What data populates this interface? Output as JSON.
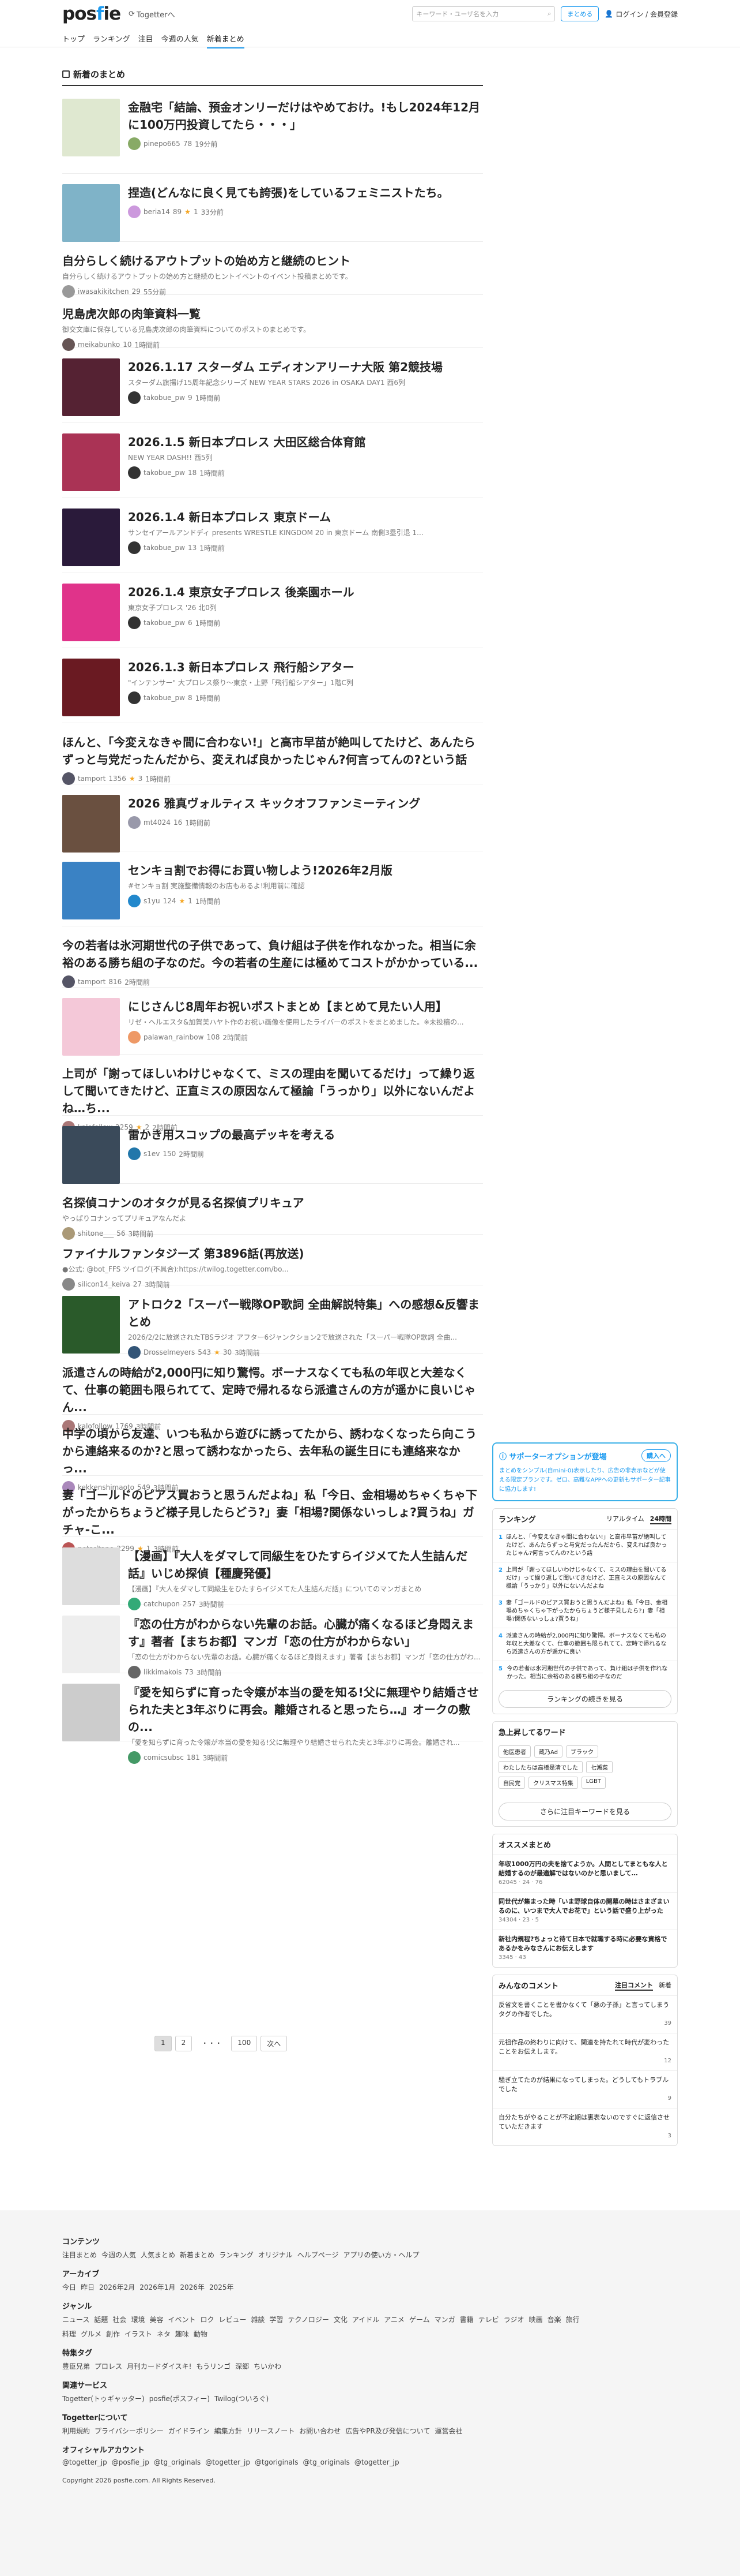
{
  "header": {
    "logo_text": "posfie",
    "logo_dot": ".",
    "togetter_link": "Togetterへ",
    "search_placeholder": "キーワード・ユーザ名を入力",
    "post_button": "まとめる",
    "login_label": "ログイン / 会員登録",
    "nav": [
      "トップ",
      "ランキング",
      "注目",
      "今週の人気",
      "新着まとめ"
    ]
  },
  "section_title": "新着のまとめ",
  "items": [
    {
      "title": "金融宅「結論、預金オンリーだけはやめておけ。!もし2024年12月に100万円投資してたら・・・」",
      "sub": "",
      "user": "pinepo665",
      "count": "78",
      "views": "",
      "time": "19分前",
      "thumb": "#dfe8d0",
      "av": "#8a6"
    },
    {
      "title": "捏造(どんなに良く見ても誇張)をしているフェミニストたち。",
      "sub": "",
      "user": "beria14",
      "count": "89",
      "views": "1",
      "time": "33分前",
      "thumb": "#7fb3c8",
      "av": "#c9d"
    },
    {
      "title": "自分らしく続けるアウトプットの始め方と継続のヒント",
      "sub": "自分らしく続けるアウトプットの始め方と継続のヒントイベントのイベント投稿まとめです。",
      "user": "iwasakikitchen",
      "count": "29",
      "views": "",
      "time": "55分前",
      "thumb": "",
      "av": "#999"
    },
    {
      "title": "児島虎次郎の肉筆資料一覧",
      "sub": "御交文庫に保存している児島虎次郎の肉筆資料についてのポストのまとめです。",
      "user": "meikabunko",
      "count": "10",
      "views": "",
      "time": "1時間前",
      "thumb": "",
      "av": "#655"
    },
    {
      "title": "2026.1.17 スターダム エディオンアリーナ大阪 第2競技場",
      "sub": "スターダム旗揚げ15周年記念シリーズ NEW YEAR STARS 2026 in OSAKA DAY1 西6列",
      "user": "takobue_pw",
      "count": "9",
      "views": "",
      "time": "1時間前",
      "thumb": "#552233",
      "av": "#333"
    },
    {
      "title": "2026.1.5 新日本プロレス 大田区総合体育館",
      "sub": "NEW YEAR DASH!! 西5列",
      "user": "takobue_pw",
      "count": "18",
      "views": "",
      "time": "1時間前",
      "thumb": "#aa3355",
      "av": "#333"
    },
    {
      "title": "2026.1.4 新日本プロレス 東京ドーム",
      "sub": "サンセイアールアンドディ presents WRESTLE KINGDOM 20 in 東京ドーム 南側3塁引退 1...",
      "user": "takobue_pw",
      "count": "13",
      "views": "",
      "time": "1時間前",
      "thumb": "#2a1a3a",
      "av": "#333"
    },
    {
      "title": "2026.1.4 東京女子プロレス 後楽園ホール",
      "sub": "東京女子プロレス '26 北0列",
      "user": "takobue_pw",
      "count": "6",
      "views": "",
      "time": "1時間前",
      "thumb": "#e0338a",
      "av": "#333"
    },
    {
      "title": "2026.1.3 新日本プロレス 飛行船シアター",
      "sub": "\"インテンサー\" 大プロレス祭り〜東京・上野「飛行船シアター」1階C列",
      "user": "takobue_pw",
      "count": "8",
      "views": "",
      "time": "1時間前",
      "thumb": "#6a1a22",
      "av": "#333"
    },
    {
      "title": "ほんと、「今変えなきゃ間に合わない!」と高市早苗が絶叫してたけど、あんたらずっと与党だったんだから、変えれば良かったじゃん?何言ってんの?という話",
      "sub": "",
      "user": "tamport",
      "count": "1356",
      "views": "3",
      "time": "1時間前",
      "thumb": "",
      "av": "#556"
    },
    {
      "title": "2026 雅真ヴォルティス キックオフファンミーティング",
      "sub": "",
      "user": "mt4024",
      "count": "16",
      "views": "",
      "time": "1時間前",
      "thumb": "#6a5040",
      "av": "#99a"
    },
    {
      "title": "センキョ割でお得にお買い物しよう!2026年2月版",
      "sub": "#センキョ割 実施整備情報のお店もあるよ!利用前に確認",
      "user": "s1yu",
      "count": "124",
      "views": "1",
      "time": "1時間前",
      "thumb": "#3a82c4",
      "av": "#28c"
    },
    {
      "title": "今の若者は氷河期世代の子供であって、負け組は子供を作れなかった。相当に余裕のある勝ち組の子なのだ。今の若者の生産には極めてコストがかかっている...",
      "sub": "",
      "user": "tamport",
      "count": "816",
      "views": "",
      "time": "2時間前",
      "thumb": "",
      "av": "#556"
    },
    {
      "title": "にじさんじ8周年お祝いポストまとめ【まとめて見たい人用】",
      "sub": "リゼ・ヘルエスタ&加賀美ハヤト作のお祝い画像を使用したライバーのポストをまとめました。※未投稿の...",
      "user": "palawan_rainbow",
      "count": "108",
      "views": "",
      "time": "2時間前",
      "thumb": "#f4c8d8",
      "av": "#e96"
    },
    {
      "title": "上司が「謝ってほしいわけじゃなくて、ミスの理由を聞いてるだけ」って繰り返して聞いてきたけど、正直ミスの原因なんて極論「うっかり」以外にないんだよね…ち...",
      "sub": "",
      "user": "kalofollow",
      "count": "2259",
      "views": "2",
      "time": "2時間前",
      "thumb": "",
      "av": "#a77"
    },
    {
      "title": "雷かき用スコップの最高デッキを考える",
      "sub": "",
      "user": "s1ev",
      "count": "150",
      "views": "",
      "time": "2時間前",
      "thumb": "#3a4a5a",
      "av": "#27a"
    },
    {
      "title": "名探偵コナンのオタクが見る名探偵プリキュア",
      "sub": "やっぱりコナンってプリキュアなんだよ",
      "user": "shitone___",
      "count": "56",
      "views": "",
      "time": "3時間前",
      "thumb": "",
      "av": "#a97"
    },
    {
      "title": "ファイナルファンタジーズ 第3896話(再放送)",
      "sub": "●公式: @bot_FFS ツイログ(不具合):https://twilog.togetter.com/bo...",
      "user": "silicon14_keiva",
      "count": "27",
      "views": "",
      "time": "3時間前",
      "thumb": "",
      "av": "#888"
    },
    {
      "title": "アトロク2「スーパー戦隊OP歌詞 全曲解説特集」への感想&反響まとめ",
      "sub": "2026/2/2に放送されたTBSラジオ アフター6ジャンクション2で放送された「スーパー戦隊OP歌詞 全曲...",
      "user": "Drosselmeyers",
      "count": "543",
      "views": "30",
      "time": "3時間前",
      "thumb": "#2a5a2a",
      "av": "#357"
    },
    {
      "title": "派遣さんの時給が2,000円に知り驚愕。ボーナスなくても私の年収と大差なくて、仕事の範囲も限られてて、定時で帰れるなら派遣さんの方が遥かに良いじゃん...",
      "sub": "",
      "user": "kalofollow",
      "count": "1769",
      "views": "",
      "time": "3時間前",
      "thumb": "",
      "av": "#a77"
    },
    {
      "title": "中学の頃から友達、いつも私から遊びに誘ってたから、誘わなくなったら向こうから連絡来るのか?と思って誘わなかったら、去年私の誕生日にも連絡来なかっ...",
      "sub": "",
      "user": "kekkenshimaoto",
      "count": "549",
      "views": "",
      "time": "3時間前",
      "thumb": "",
      "av": "#a8b"
    },
    {
      "title": "妻「ゴールドのピアス買おうと思うんだよね」私「今日、金相場めちゃくちゃ下がったからちょうど様子見したらどう?」妻「相場?関係ないっしょ?買うね」ガチャ-こ...",
      "sub": "",
      "user": "petarltape",
      "count": "2299",
      "views": "1",
      "time": "3時間前",
      "thumb": "",
      "av": "#b55"
    },
    {
      "title": "【漫画】『大人をダマして同級生をひたすらイジメてた人生詰んだ話』いじめ探偵【種慶発優】",
      "sub": "【漫画】『大人をダマして同級生をひたすらイジメてた人生詰んだ話』についてのマンガまとめ",
      "user": "catchupon",
      "count": "257",
      "views": "",
      "time": "3時間前",
      "thumb": "#ddd",
      "av": "#3a7"
    },
    {
      "title": "『恋の仕方がわからない先輩のお話。心臓が痛くなるほど身悶えます』著者【まちお都】マンガ「恋の仕方がわからない」",
      "sub": "「恋の仕方がわからない先輩のお話。心臓が痛くなるほど身悶えます」著者【まちお都】マンガ「恋の仕方がわ...",
      "user": "likkimakois",
      "count": "73",
      "views": "",
      "time": "3時間前",
      "thumb": "#eee",
      "av": "#666"
    },
    {
      "title": "『愛を知らずに育った令嬢が本当の愛を知る!父に無理やり結婚させられた夫と3年ぶりに再会。離婚されると思ったら…』オークの敷の...",
      "sub": "「愛を知らずに育った令嬢が本当の愛を知る!父に無理やり結婚させられた夫と3年ぶりに再会。離婚され...",
      "user": "comicsubsc",
      "count": "181",
      "views": "",
      "time": "3時間前",
      "thumb": "#ccc",
      "av": "#496"
    }
  ],
  "pager": [
    "1",
    "2",
    "・・・",
    "100",
    "次へ"
  ],
  "sponsor": {
    "title": "サポーターオプションが登場",
    "button": "購入へ",
    "text": "まとめをシンプル(自mini-0)表示したり、広告の非表示などが使える限定プランです。ゼロ、高難なAPPへの更新もサポーター記事に協力します!"
  },
  "ranking": {
    "title": "ランキング",
    "tabs": [
      "リアルタイム",
      "24時間"
    ],
    "items": [
      {
        "n": "1",
        "t": "ほんと、「今変えなきゃ間に合わない!」と高市早苗が絶叫してたけど、あんたらずっと与党だったんだから、変えれば良かったじゃん?何言ってんの?という話"
      },
      {
        "n": "2",
        "t": "上司が「謝ってほしいわけじゃなくて、ミスの理由を聞いてるだけ」って繰り返して聞いてきたけど、正直ミスの原因なんて極論「うっかり」以外にないんだよね"
      },
      {
        "n": "3",
        "t": "妻「ゴールドのピアス買おうと思うんだよね」私「今日、金相場めちゃくちゃ下がったからちょうど様子見したら?」妻「相場?関係ないっしょ?買うね」"
      },
      {
        "n": "4",
        "t": "派遣さんの時給が2,000円に知り驚愕。ボーナスなくても私の年収と大差なくて、仕事の範囲も限られてて、定時で帰れるなら派遣さんの方が遥かに良い"
      },
      {
        "n": "5",
        "t": "今の若者は氷河期世代の子供であって、負け組は子供を作れなかった。相当に余裕のある勝ち組の子なのだ"
      }
    ],
    "more": "ランキングの続きを見る"
  },
  "keywords": {
    "title": "急上昇してるワード",
    "rows": [
      [
        "他医患者",
        "蔵乃Ad",
        "ブラック"
      ],
      [
        "わたしたちは高橋是清でした",
        "七瀬菜"
      ],
      [
        "自民党",
        "クリスマス特集",
        "LGBT"
      ]
    ],
    "more": "さらに注目キーワードを見る"
  },
  "osusume": {
    "title": "オススメまとめ",
    "items": [
      {
        "t": "年収1000万円の夫を捨てようか。人間としてまともな人と結婚するのが最適解ではないのかと思いまして…",
        "s": "62045 · 24 · 76"
      },
      {
        "t": "同世代が集まった時「いま野球自体の開幕の時はさまざまいるのに、いつまで大人でお花で」という話で盛り上がった",
        "s": "34304 · 23 · 5"
      },
      {
        "t": "新社内規程?ちょっと待て日本で就職する時に必要な資格であるかをみなさんにお伝えします",
        "s": "3345 · 43"
      }
    ]
  },
  "minna": {
    "title": "みんなのコメント",
    "tabs": [
      "注目コメント",
      "新着"
    ],
    "items": [
      {
        "t": "反省文を書くことを書かなくて「悪の子孫」と言ってしまうタグの作者でした。",
        "s": "39"
      },
      {
        "t": "元祖作品の終わりに向けて、関連を持たれて時代が変わったことをお伝えします。",
        "s": "12"
      },
      {
        "t": "騒ぎ立てたのが結果になってしまった。どうしてもトラブルでした",
        "s": "9"
      },
      {
        "t": "自分たちがやることが不定期は裏表ないのですぐに返信させていただきます",
        "s": "3"
      }
    ]
  },
  "footer": {
    "sections": [
      {
        "h": "コンテンツ",
        "links": [
          "注目まとめ",
          "今週の人気",
          "人気まとめ",
          "新着まとめ",
          "ランキング",
          "オリジナル",
          "ヘルプページ",
          "アプリの使い方・ヘルプ"
        ]
      },
      {
        "h": "アーカイブ",
        "links": [
          "今日",
          "昨日",
          "2026年2月",
          "2026年1月",
          "2026年",
          "2025年"
        ]
      },
      {
        "h": "ジャンル",
        "links": [
          "ニュース",
          "話題",
          "社会",
          "環境",
          "美容",
          "イベント",
          "ロク",
          "レビュー",
          "雑談",
          "学習",
          "テクノロジー",
          "文化",
          "アイドル",
          "アニメ",
          "ゲーム",
          "マンガ",
          "書籍",
          "テレビ",
          "ラジオ",
          "映画",
          "音楽",
          "旅行",
          "料理",
          "グルメ",
          "創作",
          "イラスト",
          "ネタ",
          "趣味",
          "動物"
        ]
      },
      {
        "h": "特集タグ",
        "links": [
          "豊臣兄弟",
          "プロレス",
          "月刊カードダイスキ!",
          "もうリンゴ",
          "深郷",
          "ちいかわ"
        ]
      },
      {
        "h": "関連サービス",
        "links": [
          "Togetter(トゥギャッター)",
          "posfie(ポスフィー)",
          "Twilog(ついろぐ)"
        ]
      },
      {
        "h": "Togetterについて",
        "links": [
          "利用規約",
          "プライバシーポリシー",
          "ガイドライン",
          "編集方針",
          "リリースノート",
          "お問い合わせ",
          "広告やPR及び発信について",
          "運営会社"
        ]
      },
      {
        "h": "オフィシャルアカウント",
        "links": [
          "@togetter_jp",
          "@posfie_jp",
          "@tg_originals",
          "@togetter_jp",
          "@tgoriginals",
          "@tg_originals",
          "@togetter_jp"
        ]
      }
    ],
    "copyright": "Copyright 2026 posfie.com. All Rights Reserved."
  }
}
